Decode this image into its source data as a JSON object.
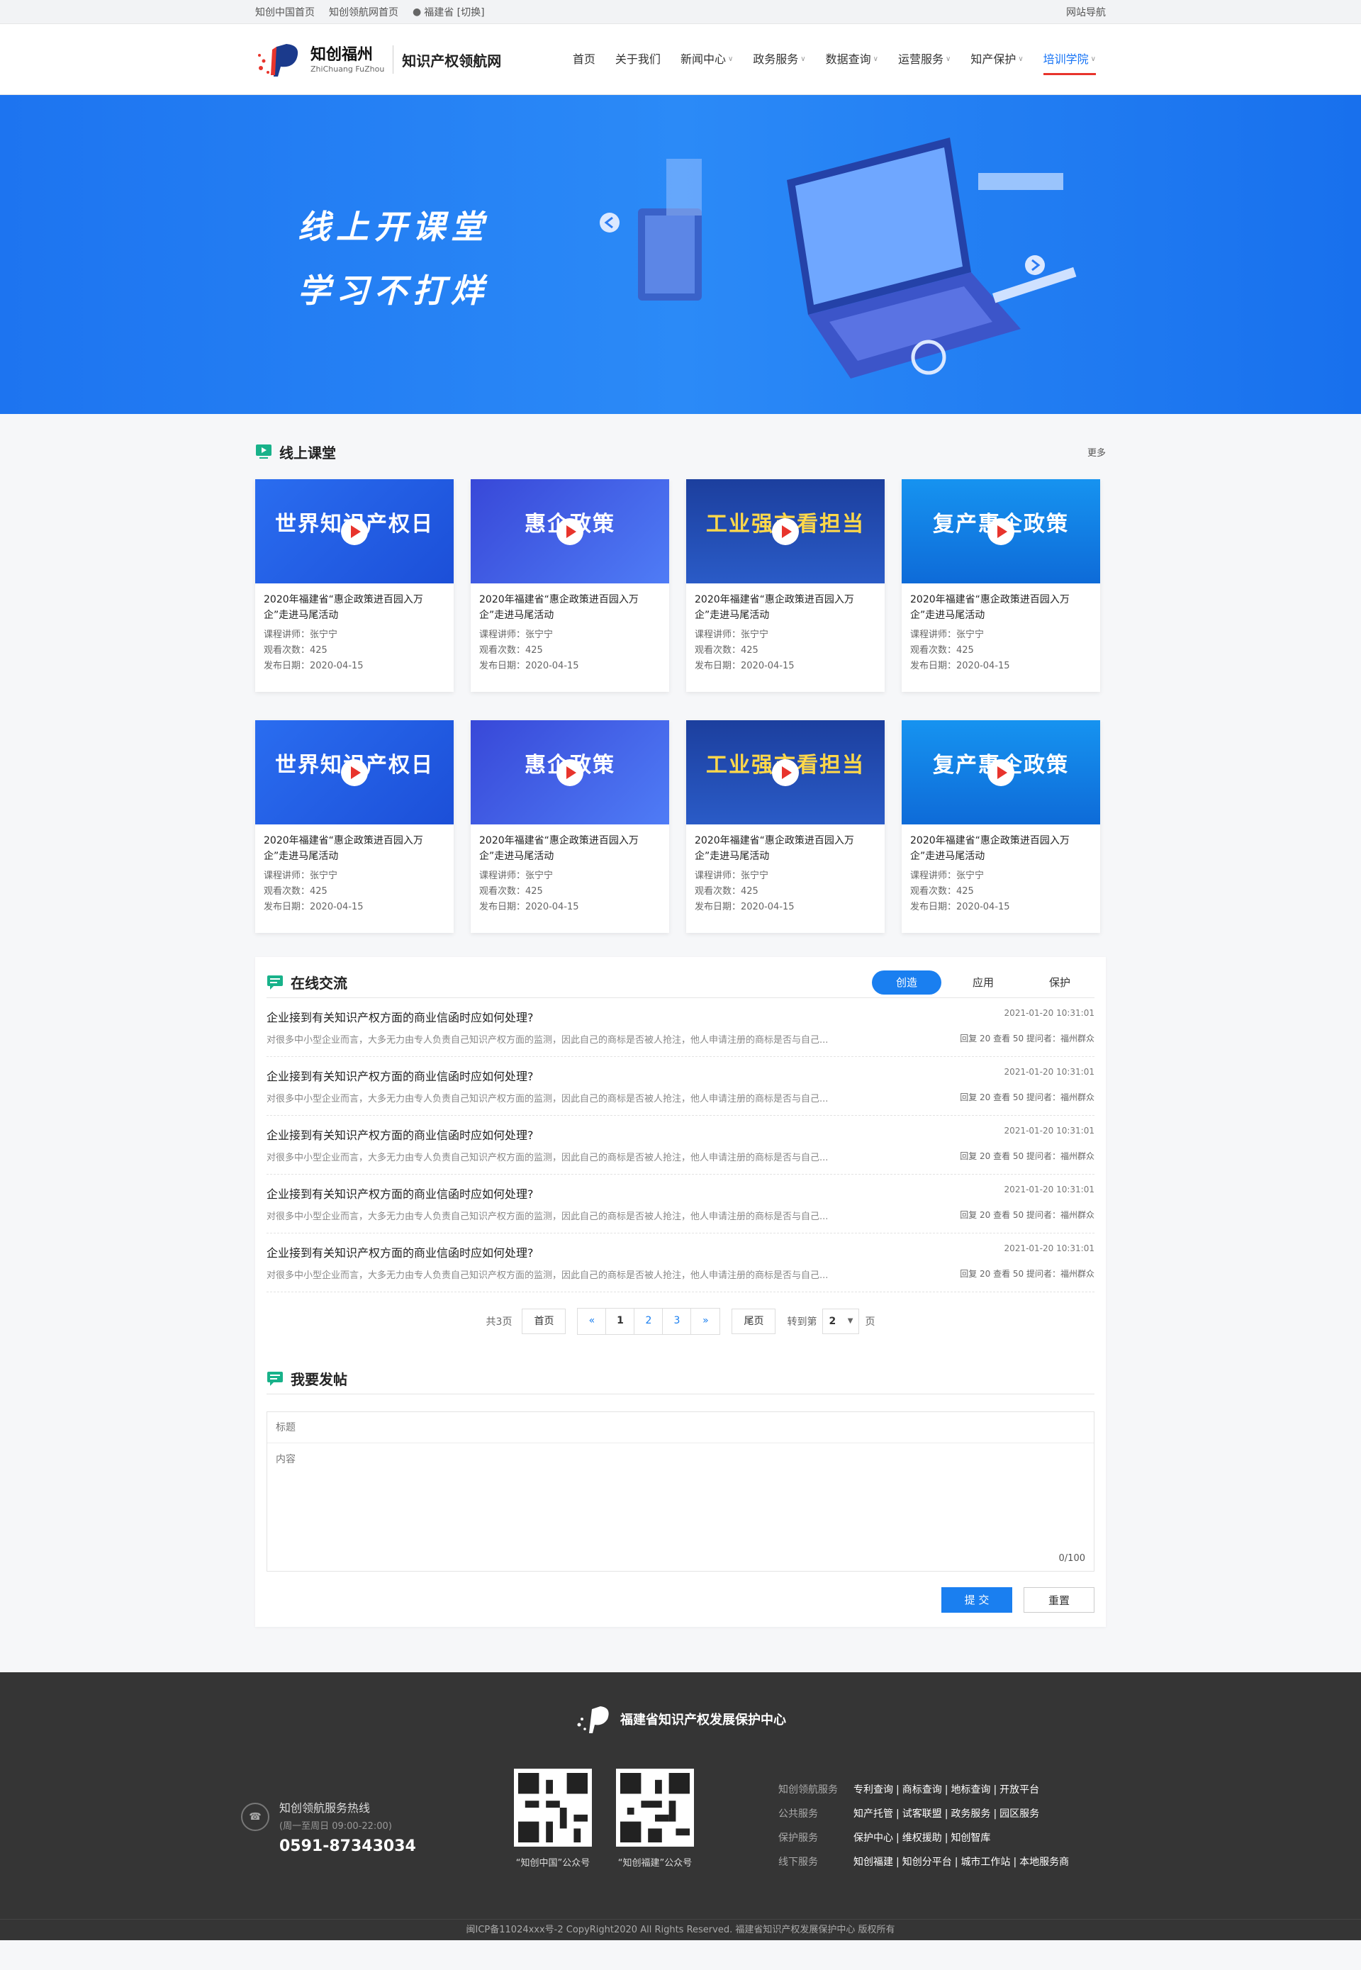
{
  "topbar": {
    "links": [
      "知创中国首页",
      "知创领航网首页"
    ],
    "location": "福建省 [切换]",
    "sitemap": "网站导航"
  },
  "header": {
    "brand": "知创福州",
    "brand_sub": "ZhiChuang FuZhou",
    "site_name": "知识产权领航网",
    "nav": [
      {
        "label": "首页"
      },
      {
        "label": "关于我们"
      },
      {
        "label": "新闻中心"
      },
      {
        "label": "政务服务"
      },
      {
        "label": "数据查询"
      },
      {
        "label": "运营服务"
      },
      {
        "label": "知产保护"
      },
      {
        "label": "培训学院"
      }
    ]
  },
  "banner": {
    "line1": "线上开课堂",
    "line2": "学习不打烊"
  },
  "courses": {
    "title": "线上课堂",
    "more": "更多",
    "thumb_titles": [
      "世界知识产权日",
      "惠企政策",
      "工业强市看担当",
      "复产惠企政策"
    ],
    "items": [
      {
        "title": "2020年福建省“惠企政策进百园入万企”走进马尾活动",
        "teacher": "课程讲师：张宁宁",
        "views": "观看次数：425",
        "date": "发布日期：2020-04-15"
      },
      {
        "title": "2020年福建省“惠企政策进百园入万企”走进马尾活动",
        "teacher": "课程讲师：张宁宁",
        "views": "观看次数：425",
        "date": "发布日期：2020-04-15"
      },
      {
        "title": "2020年福建省“惠企政策进百园入万企”走进马尾活动",
        "teacher": "课程讲师：张宁宁",
        "views": "观看次数：425",
        "date": "发布日期：2020-04-15"
      },
      {
        "title": "2020年福建省“惠企政策进百园入万企”走进马尾活动",
        "teacher": "课程讲师：张宁宁",
        "views": "观看次数：425",
        "date": "发布日期：2020-04-15"
      },
      {
        "title": "2020年福建省“惠企政策进百园入万企”走进马尾活动",
        "teacher": "课程讲师：张宁宁",
        "views": "观看次数：425",
        "date": "发布日期：2020-04-15"
      },
      {
        "title": "2020年福建省“惠企政策进百园入万企”走进马尾活动",
        "teacher": "课程讲师：张宁宁",
        "views": "观看次数：425",
        "date": "发布日期：2020-04-15"
      },
      {
        "title": "2020年福建省“惠企政策进百园入万企”走进马尾活动",
        "teacher": "课程讲师：张宁宁",
        "views": "观看次数：425",
        "date": "发布日期：2020-04-15"
      },
      {
        "title": "2020年福建省“惠企政策进百园入万企”走进马尾活动",
        "teacher": "课程讲师：张宁宁",
        "views": "观看次数：425",
        "date": "发布日期：2020-04-15"
      }
    ]
  },
  "forum": {
    "title": "在线交流",
    "tabs": [
      "创造",
      "应用",
      "保护"
    ],
    "post": {
      "question": "企业接到有关知识产权方面的商业信函时应如何处理?",
      "abstract": "对很多中小型企业而言，大多无力由专人负责自己知识产权方面的监测，因此自己的商标是否被人抢注，他人申请注册的商标是否与自己...",
      "time": "2021-01-20    10:31:01",
      "stats": "回复 20  查看 50  提问者：福州群众"
    },
    "pager": {
      "total": "共3页",
      "first": "首页",
      "prev": "«",
      "pages": [
        "1",
        "2",
        "3"
      ],
      "next": "»",
      "last": "尾页",
      "goto": "转到第",
      "goto_val": "2",
      "unit": "页"
    }
  },
  "compose": {
    "title": "我要发帖",
    "title_ph": "标题",
    "content_ph": "内容",
    "counter": "0/100",
    "submit": "提 交",
    "reset": "重置"
  },
  "footer": {
    "org": "福建省知识产权发展保护中心",
    "hotline_label": "知创领航服务热线",
    "hotline_hours": "(周一至周日 09:00-22:00)",
    "hotline": "0591-87343034",
    "qr": [
      "“知创中国”公众号",
      "“知创福建”公众号"
    ],
    "links": [
      {
        "label": "知创领航服务",
        "items": [
          "专利查询",
          "商标查询",
          "地标查询",
          "开放平台"
        ]
      },
      {
        "label": "公共服务",
        "items": [
          "知产托管",
          "试客联盟",
          "政务服务",
          "园区服务"
        ]
      },
      {
        "label": "保护服务",
        "items": [
          "保护中心",
          "维权援助",
          "知创智库"
        ]
      },
      {
        "label": "线下服务",
        "items": [
          "知创福建",
          "知创分平台",
          "城市工作站",
          "本地服务商"
        ]
      }
    ],
    "copyright": "闽ICP备11024xxx号-2  CopyRight2020  All Rights Reserved.  福建省知识产权发展保护中心 版权所有"
  },
  "colors": {
    "primary": "#1a7ff0",
    "accent": "#e8342c",
    "footer": "#353535"
  }
}
